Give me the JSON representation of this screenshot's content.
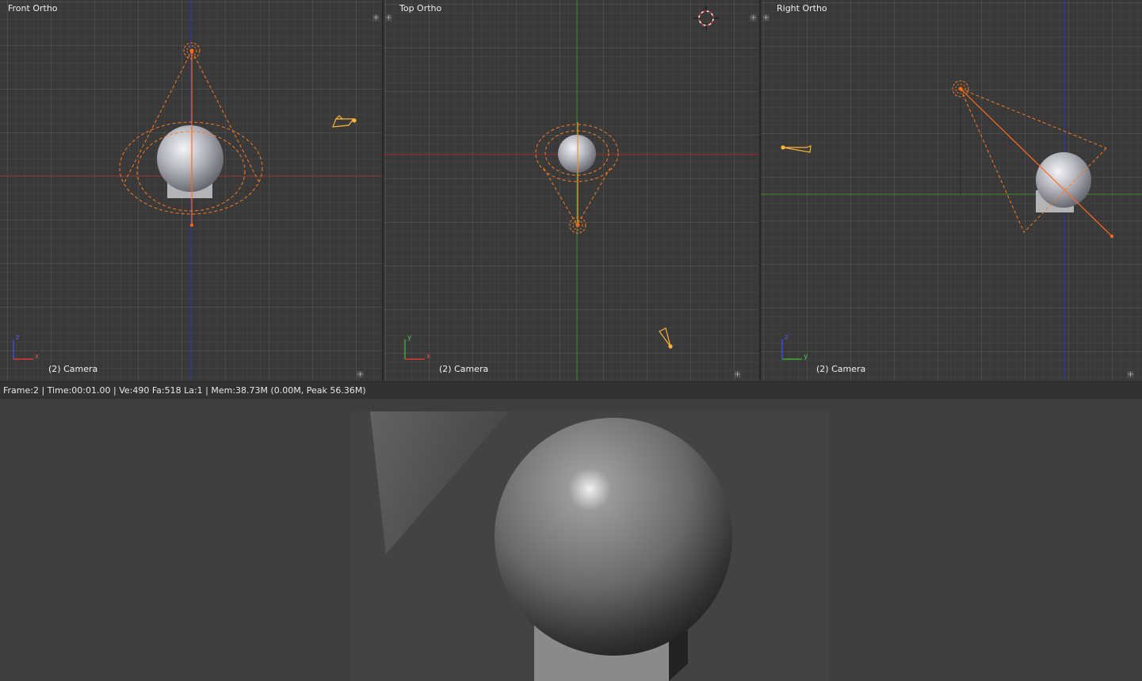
{
  "viewports": [
    {
      "id": "front",
      "title": "Front Ortho",
      "camera_label": "(2) Camera",
      "axes": [
        "z",
        "x"
      ]
    },
    {
      "id": "top",
      "title": "Top Ortho",
      "camera_label": "(2) Camera",
      "axes": [
        "y",
        "x"
      ]
    },
    {
      "id": "right",
      "title": "Right Ortho",
      "camera_label": "(2) Camera",
      "axes": [
        "z",
        "y"
      ]
    }
  ],
  "status": {
    "text": "Frame:2 | Time:00:01.00 | Ve:490 Fa:518 La:1 | Mem:38.73M (0.00M, Peak 56.36M)"
  },
  "icons": {
    "corner": "plus-icon",
    "cursor": "3d-cursor-icon",
    "camera": "camera-icon",
    "lamp": "spot-lamp-icon"
  },
  "colors": {
    "grid_bg": "#393939",
    "selection_orange": "#ff8c00",
    "axis_x": "#b03030",
    "axis_y": "#3a8a2a",
    "axis_z": "#2a3ab0"
  }
}
